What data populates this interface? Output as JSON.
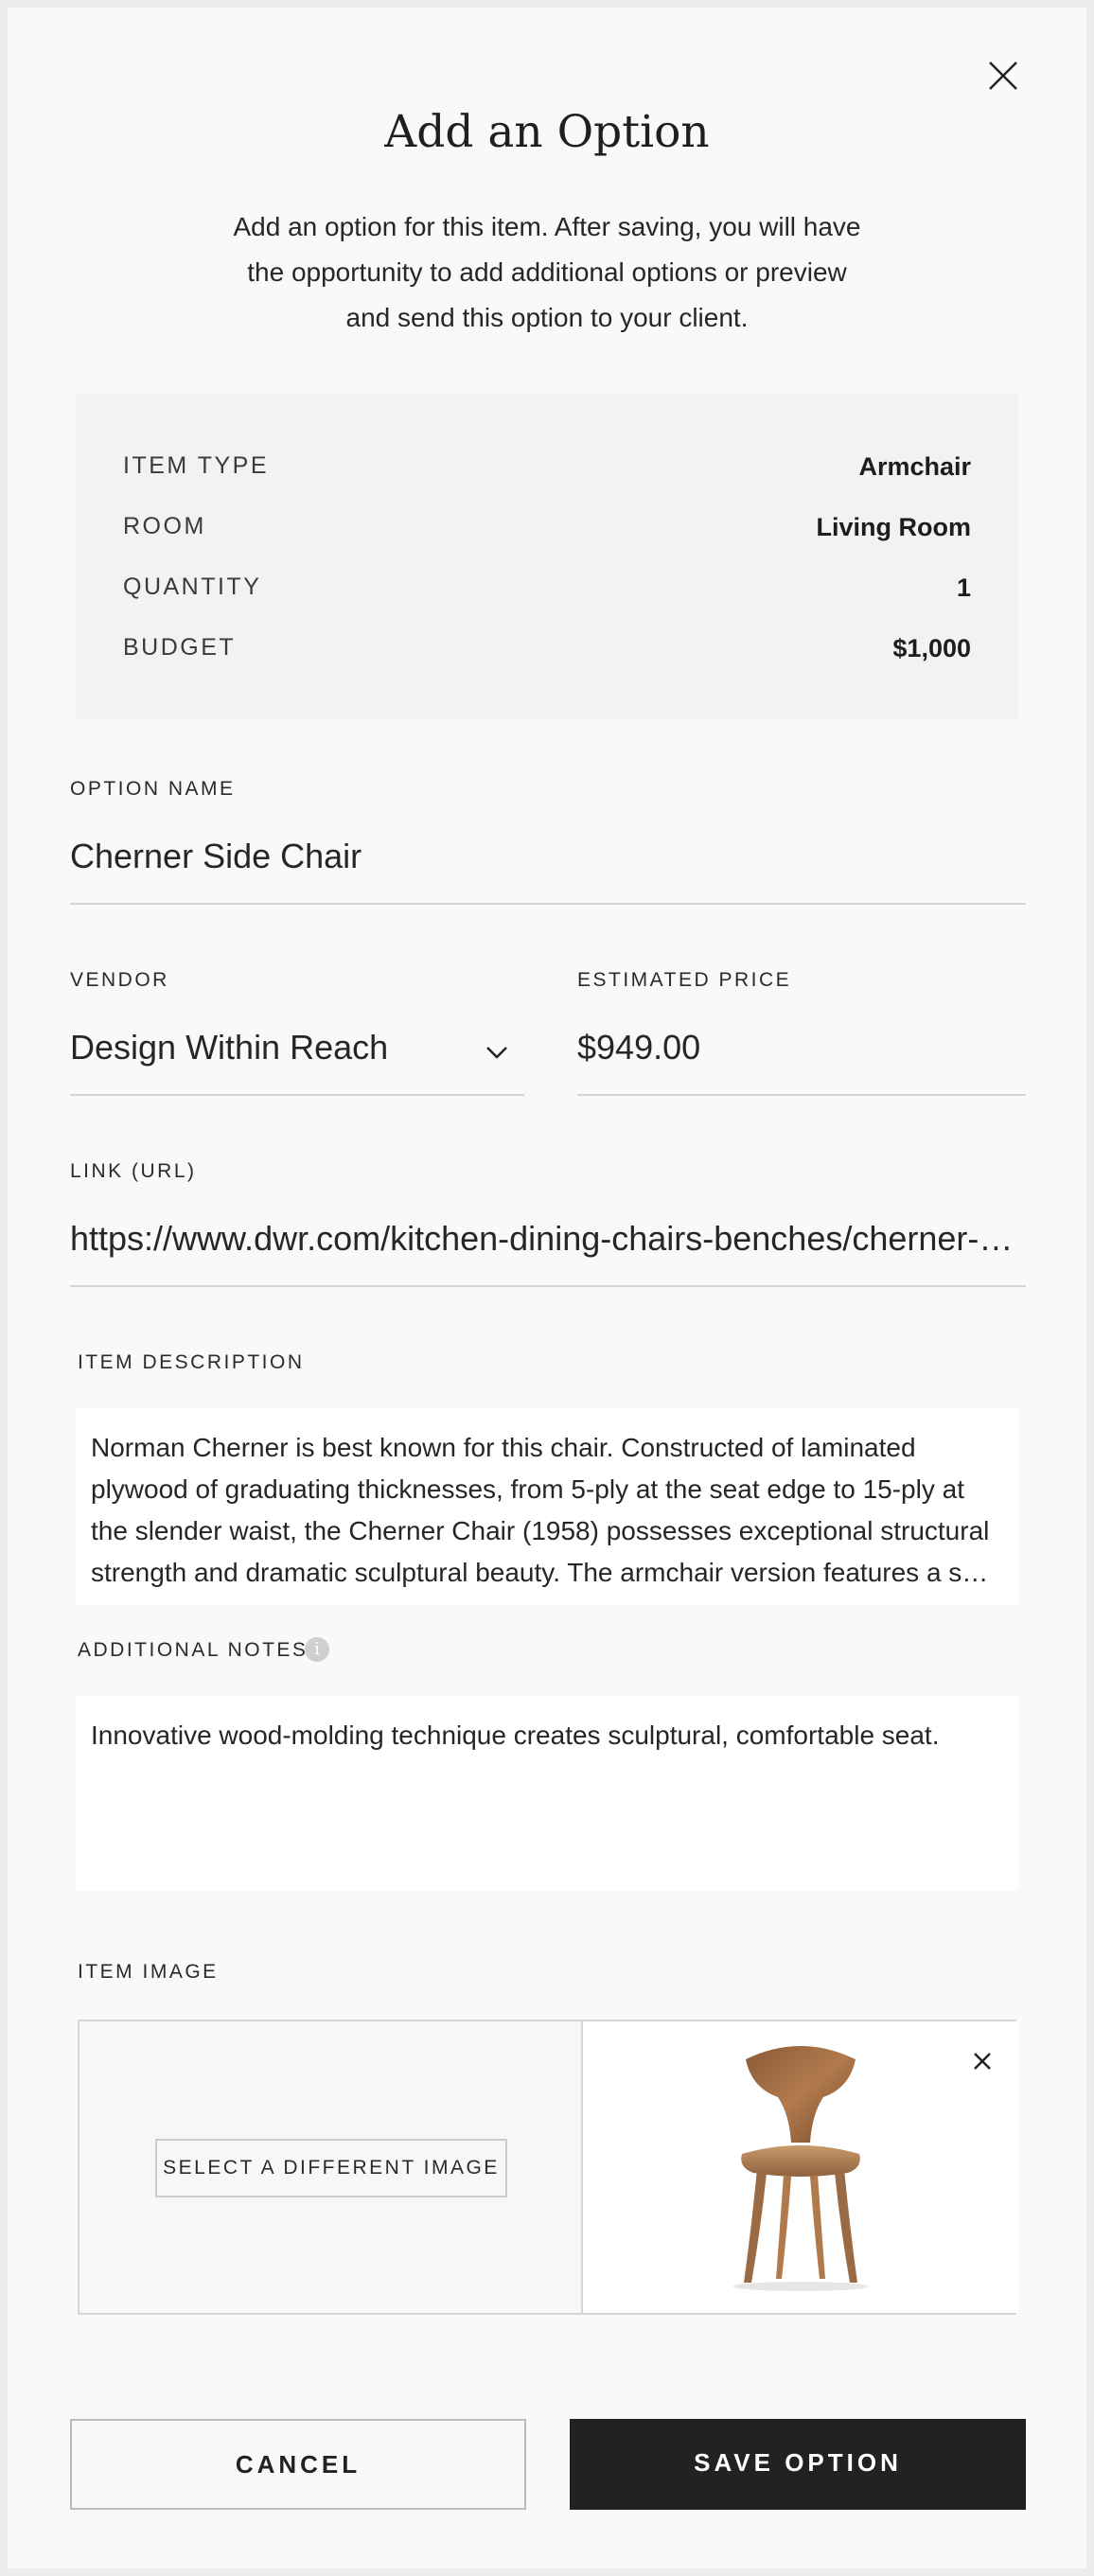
{
  "dialog": {
    "title": "Add an Option",
    "intro_lines": [
      "Add an option for this item. After saving, you will have",
      "the opportunity to add additional options or preview",
      "and send this option to your client."
    ],
    "close_icon": "close-icon"
  },
  "summary": {
    "rows": [
      {
        "label": "ITEM TYPE",
        "value": "Armchair"
      },
      {
        "label": "ROOM",
        "value": "Living Room"
      },
      {
        "label": "QUANTITY",
        "value": "1"
      },
      {
        "label": "BUDGET",
        "value": "$1,000"
      }
    ]
  },
  "form": {
    "option_name": {
      "label": "OPTION NAME",
      "value": "Cherner Side Chair"
    },
    "vendor": {
      "label": "VENDOR",
      "value": "Design Within Reach",
      "icon": "chevron-down-icon"
    },
    "estimated_price": {
      "label": "ESTIMATED PRICE",
      "value": "$949.00"
    },
    "link": {
      "label": "LINK (URL)",
      "value": "https://www.dwr.com/kitchen-dining-chairs-benches/cherner-side-chair"
    },
    "item_description": {
      "label": "ITEM DESCRIPTION",
      "lines": [
        "Norman Cherner is best known for this chair. Constructed of laminated",
        "plywood of graduating thicknesses, from 5-ply at the seat edge to 15-ply at",
        "the slender waist, the Cherner Chair (1958) possesses exceptional structural",
        "strength and dramatic sculptural beauty. The armchair version features a s…"
      ]
    },
    "additional_notes": {
      "label": "ADDITIONAL NOTES",
      "info_icon": "info-icon",
      "info_glyph": "i",
      "value": "Innovative wood-molding technique creates sculptural, comfortable seat."
    },
    "item_image": {
      "label": "ITEM IMAGE",
      "select_button": "SELECT A DIFFERENT IMAGE",
      "remove_icon": "close-icon"
    }
  },
  "actions": {
    "cancel": "CANCEL",
    "save": "SAVE OPTION"
  },
  "colors": {
    "background": "#f9f9f9",
    "summary_bg": "#f2f2f2",
    "primary_button": "#222222",
    "text": "#1e1e1e",
    "divider": "#d3d3d3"
  }
}
